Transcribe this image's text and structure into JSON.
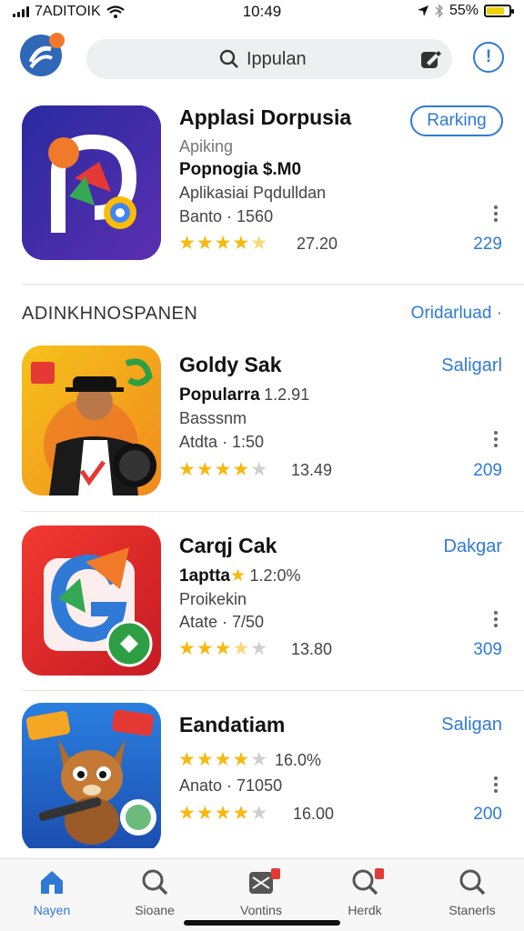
{
  "status_bar": {
    "carrier": "7ADITOIK",
    "time": "10:49",
    "battery": "55%"
  },
  "header": {
    "search_text": "Ippulan"
  },
  "featured": {
    "title": "Applasi Dorpusia",
    "button": "Rarking",
    "line1": "Apiking",
    "line2": "Popnogia $.M0",
    "line3": "Aplikasiai Pqdulldan",
    "line4": "Banto · 1560",
    "rating": 4.5,
    "rating_label": "27.20",
    "count": "229"
  },
  "section": {
    "title": "ADINKHNOSPANEN",
    "link": "Oridarluad ·"
  },
  "apps": [
    {
      "title": "Goldy Sak",
      "action": "Saligarl",
      "line1": "Popularra",
      "line1_extra": "1.2.91",
      "line2": "Basssnm",
      "line3": "Atdta · 1:50",
      "rating": 4,
      "rating_label": "13.49",
      "count": "209"
    },
    {
      "title": "Carqj Cak",
      "action": "Dakgar",
      "line1": "1aptta",
      "line1_extra": "1.2:0%",
      "line2": "Proikekin",
      "line3": "Atate · 7/50",
      "rating": 3.5,
      "rating_label": "13.80",
      "count": "309"
    },
    {
      "title": "Eandatiam",
      "action": "Saligan",
      "line1": "",
      "line1_extra": "16.0%",
      "line2": "",
      "line3": "Anato · 71050",
      "rating": 4,
      "rating_label": "16.00",
      "count": "200"
    }
  ],
  "tabs": [
    {
      "label": "Nayen"
    },
    {
      "label": "Sioane"
    },
    {
      "label": "Vontins"
    },
    {
      "label": "Herdk"
    },
    {
      "label": "Stanerls"
    }
  ],
  "colors": {
    "accent": "#2f7ad6",
    "star": "#f5b90f",
    "badge": "#e53935"
  }
}
